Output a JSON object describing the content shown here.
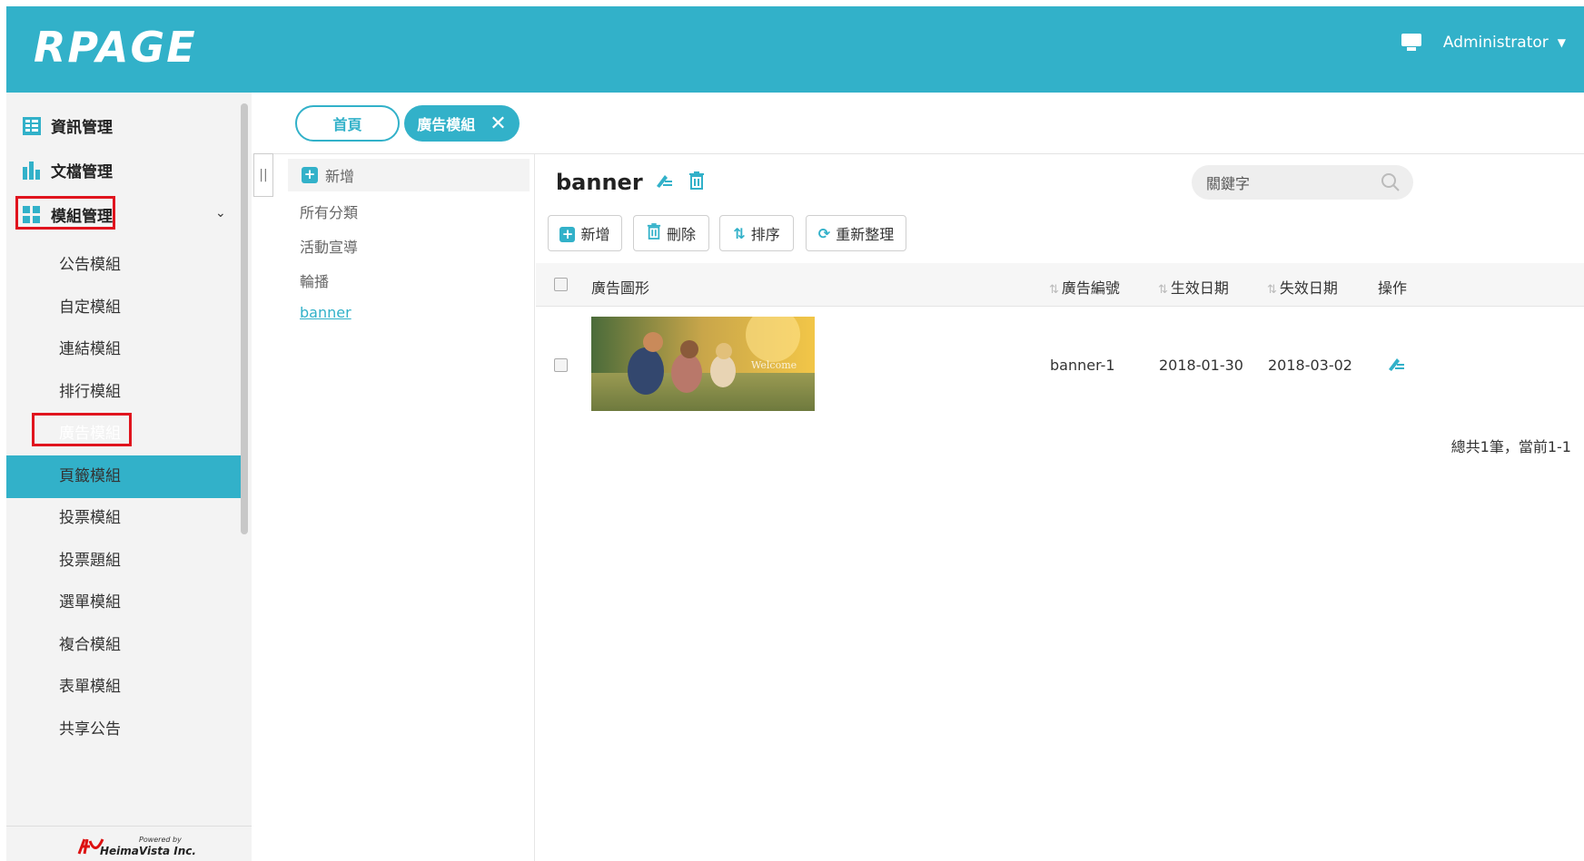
{
  "header": {
    "logo": "RPAGE",
    "user": "Administrator"
  },
  "sidebar": {
    "top_items": [
      {
        "label": "資訊管理"
      },
      {
        "label": "文檔管理"
      },
      {
        "label": "模組管理"
      }
    ],
    "sub_items": [
      "公告模組",
      "自定模組",
      "連結模組",
      "排行模組",
      "廣告模組",
      "頁籤模組",
      "投票模組",
      "投票題組",
      "選單模組",
      "複合模組",
      "表單模組",
      "共享公告"
    ],
    "active_sub": "廣告模組",
    "powered_small": "Powered by",
    "powered_brand": "HeimaVista Inc."
  },
  "tabs": {
    "home": "首頁",
    "current": "廣告模組"
  },
  "tree": {
    "add": "新增",
    "items": [
      "所有分類",
      "活動宣導",
      "輪播"
    ],
    "link": "banner"
  },
  "main": {
    "title": "banner",
    "search_placeholder": "關鍵字",
    "buttons": {
      "add": "新增",
      "delete": "刪除",
      "sort": "排序",
      "refresh": "重新整理"
    },
    "columns": {
      "image": "廣告圖形",
      "code": "廣告編號",
      "start": "生效日期",
      "end": "失效日期",
      "action": "操作"
    },
    "rows": [
      {
        "image_caption": "Welcome",
        "code": "banner-1",
        "start": "2018-01-30",
        "end": "2018-03-02"
      }
    ],
    "count": "總共1筆，當前1-1"
  },
  "colors": {
    "accent": "#32b1c9",
    "highlight_box": "#e0141e"
  }
}
